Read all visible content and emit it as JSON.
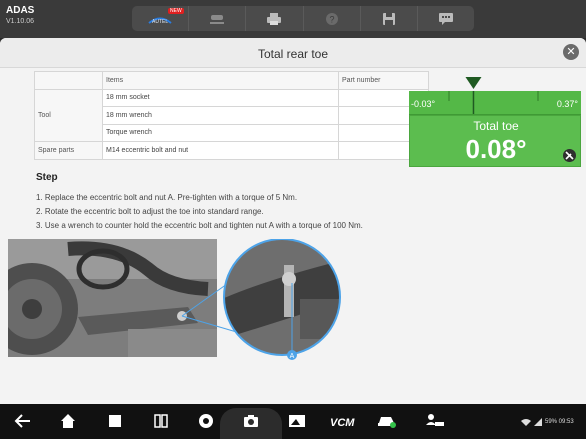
{
  "app": {
    "title": "ADAS",
    "version": "V1.10.06"
  },
  "toolbar": {
    "buttons": [
      {
        "name": "autel-button",
        "icon": "autel-logo-icon",
        "badge": "NEW"
      },
      {
        "name": "vehicle-button",
        "icon": "car-lift-icon"
      },
      {
        "name": "print-button",
        "icon": "printer-icon"
      },
      {
        "name": "help-button",
        "icon": "help-icon"
      },
      {
        "name": "save-button",
        "icon": "floppy-disk-icon"
      },
      {
        "name": "feedback-button",
        "icon": "chat-icon"
      }
    ]
  },
  "dialog": {
    "title": "Total rear toe",
    "close_icon": "close-icon"
  },
  "parts_table": {
    "headers": [
      "",
      "Items",
      "Part number"
    ],
    "tool_label": "Tool",
    "tools": [
      "18 mm socket",
      "18 mm wrench",
      "Torque wrench"
    ],
    "spare_label": "Spare parts",
    "spare": "M14 eccentric bolt and nut"
  },
  "toe": {
    "label": "Total toe",
    "value": "0.08°",
    "min": "-0.03°",
    "max": "0.37°",
    "reading": 0.08,
    "range": [
      -0.03,
      0.37
    ],
    "colors": {
      "in_range": "#5cbd4f",
      "marker": "#1f5a22"
    }
  },
  "steps": {
    "heading": "Step",
    "items": [
      "1. Replace the eccentric bolt and nut A. Pre-tighten with a torque of 5 Nm.",
      "2. Rotate the eccentric bolt to adjust the toe into standard range.",
      "3. Use a wrench to counter hold the eccentric bolt and tighten nut A with a torque of 100 Nm."
    ]
  },
  "illustration": {
    "callout_label": "A"
  },
  "system": {
    "status": "59% 09:53",
    "vcm_label": "VCM",
    "nav_icons": [
      "back-icon",
      "home-icon",
      "recents-icon",
      "split-icon",
      "chrome-icon",
      "camera-icon",
      "gallery-icon",
      "vcm-icon",
      "car-icon",
      "user-car-icon"
    ]
  }
}
